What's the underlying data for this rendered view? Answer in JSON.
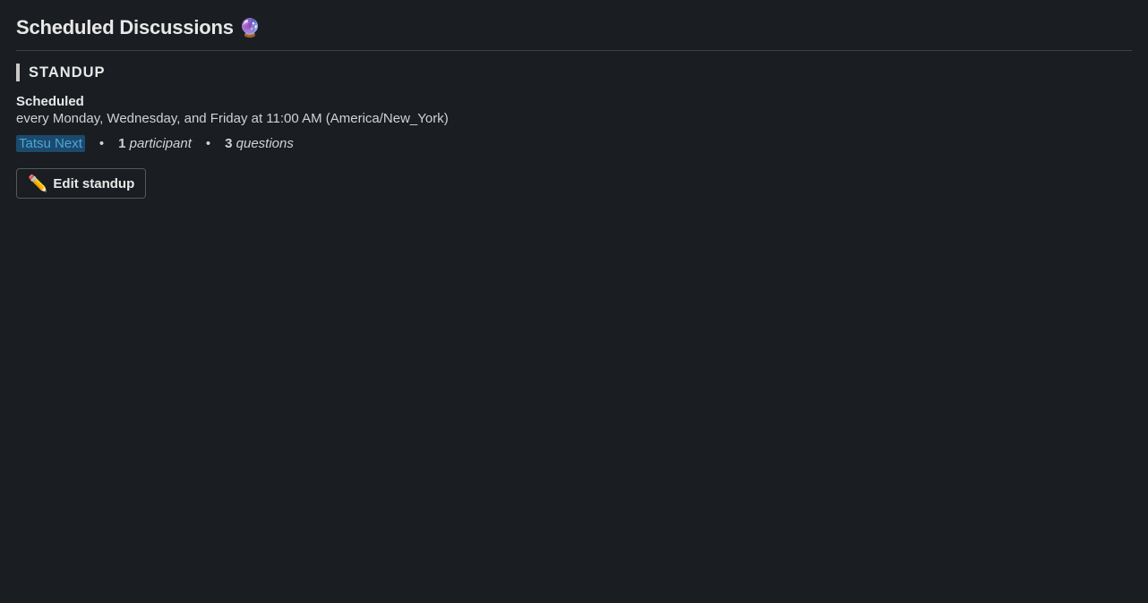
{
  "page": {
    "title": "Scheduled Discussions",
    "title_emoji": "🔮"
  },
  "section": {
    "heading": "STANDUP"
  },
  "standup": {
    "status_label": "Scheduled",
    "schedule_text": "every Monday, Wednesday, and Friday at 11:00 AM (America/New_York)",
    "channel": "Tatsu Next",
    "participants_count": "1",
    "participants_label": "participant",
    "questions_count": "3",
    "questions_label": "questions",
    "bullet": "•"
  },
  "actions": {
    "edit_emoji": "✏️",
    "edit_label": "Edit standup"
  }
}
